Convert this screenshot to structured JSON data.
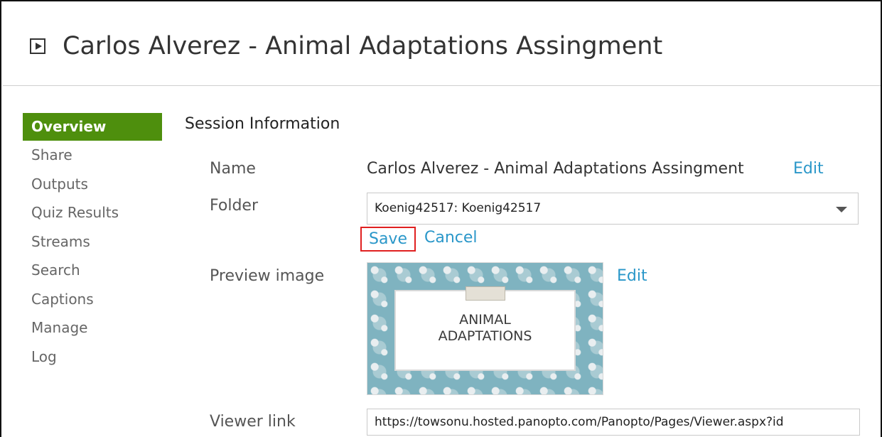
{
  "header": {
    "title": "Carlos Alverez - Animal Adaptations Assingment",
    "icon": "play-icon"
  },
  "sidebar": {
    "items": [
      {
        "label": "Overview",
        "active": true
      },
      {
        "label": "Share"
      },
      {
        "label": "Outputs"
      },
      {
        "label": "Quiz Results"
      },
      {
        "label": "Streams"
      },
      {
        "label": "Search"
      },
      {
        "label": "Captions"
      },
      {
        "label": "Manage"
      },
      {
        "label": "Log"
      }
    ],
    "active_color": "#4e8f0d"
  },
  "session": {
    "section_title": "Session Information",
    "name_label": "Name",
    "name_value": "Carlos Alverez - Animal Adaptations Assingment",
    "name_edit": "Edit",
    "folder_label": "Folder",
    "folder_value": "Koenig42517: Koenig42517",
    "save_label": "Save",
    "cancel_label": "Cancel",
    "preview_label": "Preview image",
    "preview_text": "ANIMAL\nADAPTATIONS",
    "preview_edit": "Edit",
    "viewer_label": "Viewer link",
    "viewer_value": "https://towsonu.hosted.panopto.com/Panopto/Pages/Viewer.aspx?id"
  },
  "colors": {
    "link": "#2a97c9",
    "highlight_border": "#e02020"
  }
}
